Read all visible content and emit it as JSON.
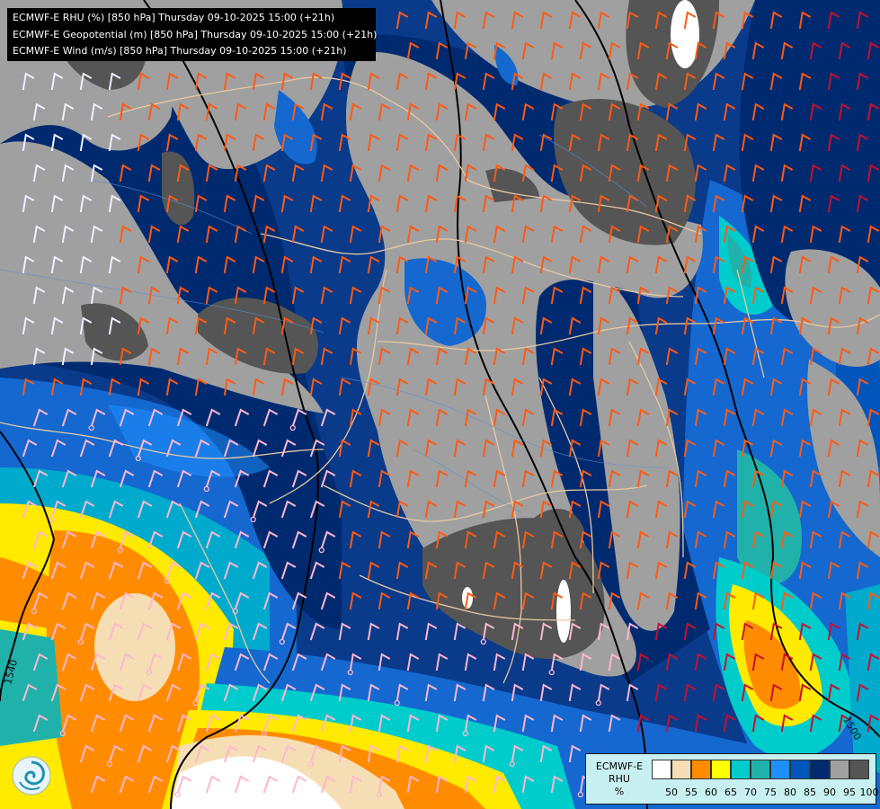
{
  "header": {
    "line1": "ECMWF-E RHU (%) [850 hPa] Thursday 09-10-2025 15:00 (+21h)",
    "line2": "ECMWF-E Geopotential (m) [850 hPa] Thursday 09-10-2025 15:00 (+21h)",
    "line3": "ECMWF-E Wind (m/s) [850 hPa] Thursday 09-10-2025 15:00 (+21h)"
  },
  "contour_labels": {
    "left": "1540",
    "right": "1500"
  },
  "legend": {
    "title_line1": "ECMWF-E",
    "title_line2": "RHU",
    "title_line3": "%",
    "levels": [
      "50",
      "55",
      "60",
      "65",
      "70",
      "75",
      "80",
      "85",
      "90",
      "95",
      "100"
    ],
    "colors": [
      "#ffffff",
      "#f5deb3",
      "#ff8c00",
      "#ffff00",
      "#00cccc",
      "#20b2aa",
      "#1e90ff",
      "#0055bb",
      "#002a70",
      "#a0a0a0",
      "#555555"
    ]
  },
  "logo_icon": "ecmwf-swirl-icon"
}
